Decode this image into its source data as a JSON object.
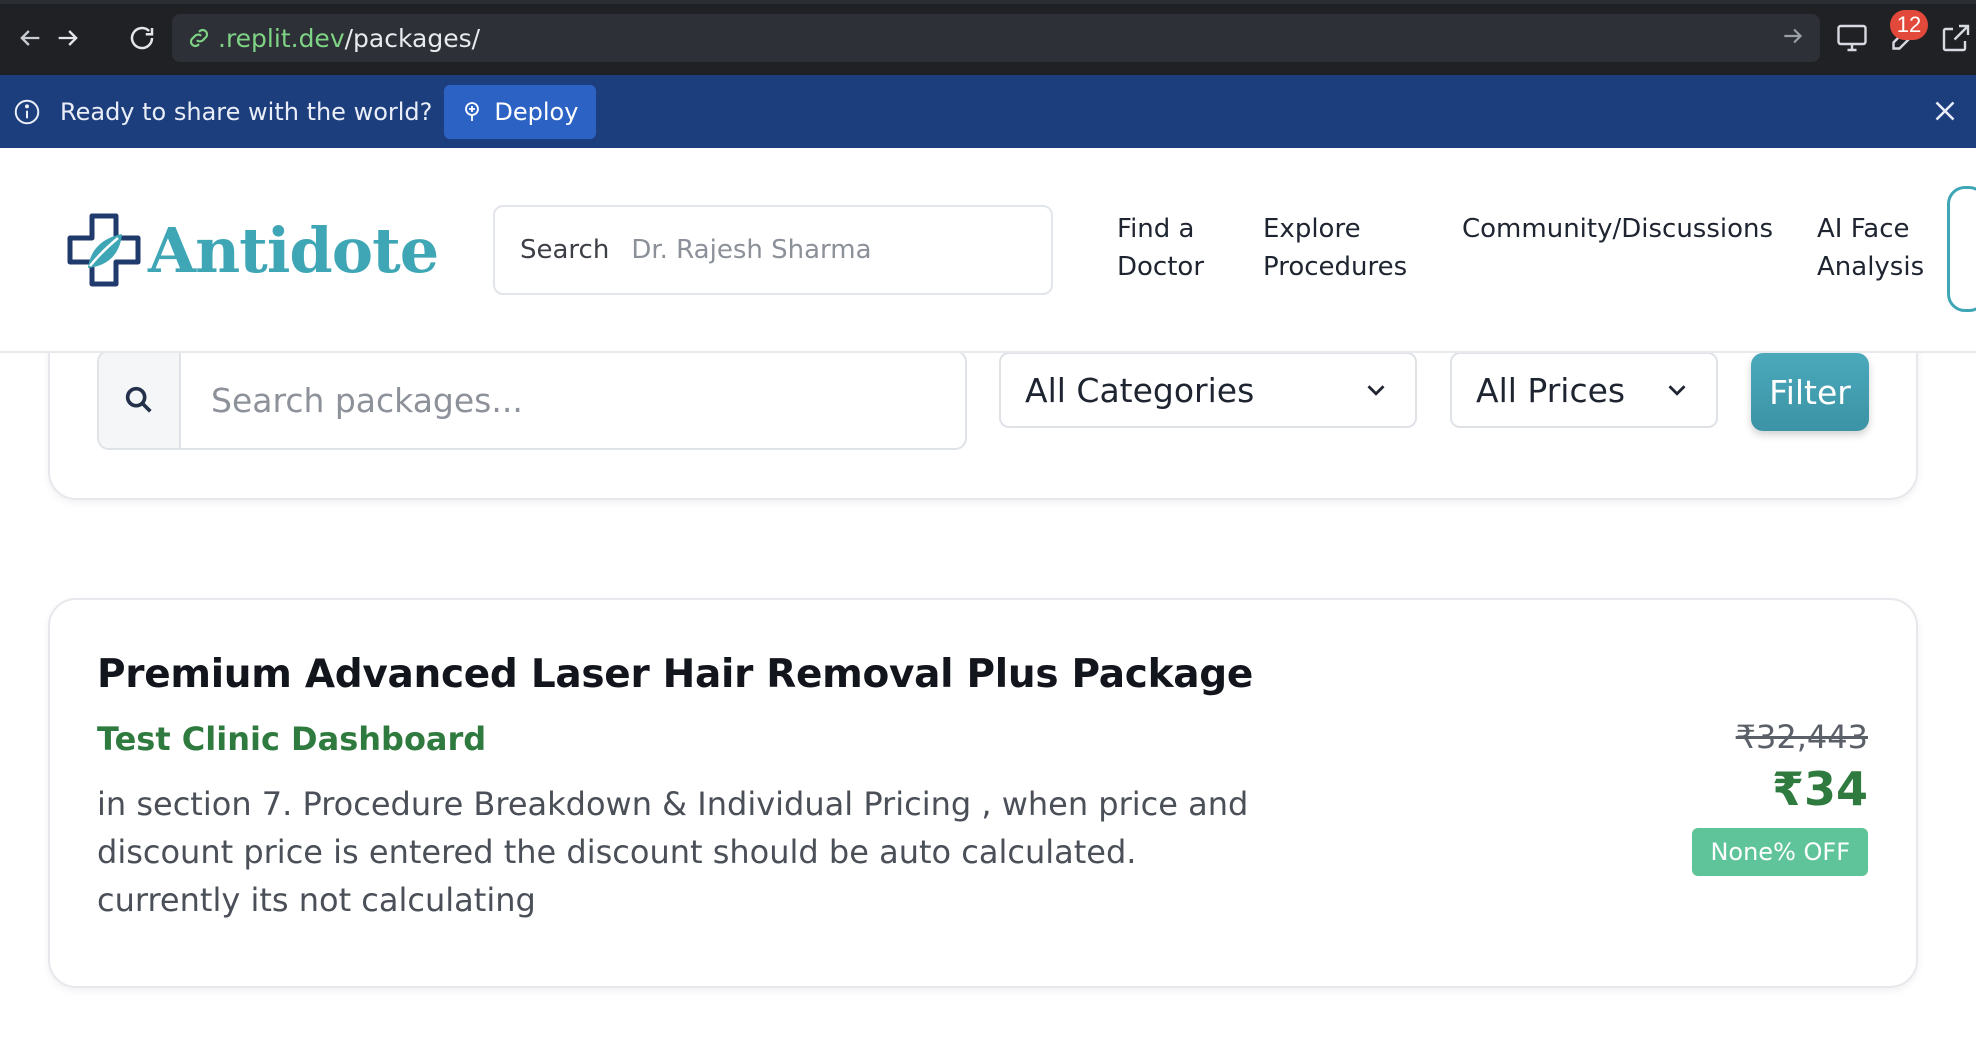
{
  "browser": {
    "url_host": ".replit.dev",
    "url_path": "/packages/",
    "notification_count": "12"
  },
  "banner": {
    "message": "Ready to share with the world?",
    "deploy_label": "Deploy"
  },
  "header": {
    "brand": "Antidote",
    "search_label": "Search",
    "search_rotating_text": "Dr. Rajesh Sharma",
    "nav": [
      {
        "line1": "Find a",
        "line2": "Doctor"
      },
      {
        "line1": "Explore",
        "line2": "Procedures"
      },
      {
        "line1": "Community/Discussions",
        "line2": ""
      },
      {
        "line1": "AI Face",
        "line2": "Analysis"
      }
    ]
  },
  "filters": {
    "search_placeholder": "Search packages...",
    "category_selected": "All Categories",
    "price_selected": "All Prices",
    "filter_label": "Filter"
  },
  "package": {
    "title": "Premium Advanced Laser Hair Removal Plus Package",
    "clinic": "Test Clinic Dashboard",
    "description": "in section 7. Procedure Breakdown & Individual Pricing , when price and discount price is entered the discount should be auto calculated. currently its not calculating",
    "original_price": "₹32,443",
    "discount_price": "₹34",
    "discount_badge": "None% OFF"
  },
  "colors": {
    "brand_teal": "#3fa6b6",
    "brand_navy": "#1f3a6b",
    "clinic_green": "#2f7a3e",
    "banner_blue": "#1d3e7c",
    "badge_green": "#5fc49a"
  }
}
